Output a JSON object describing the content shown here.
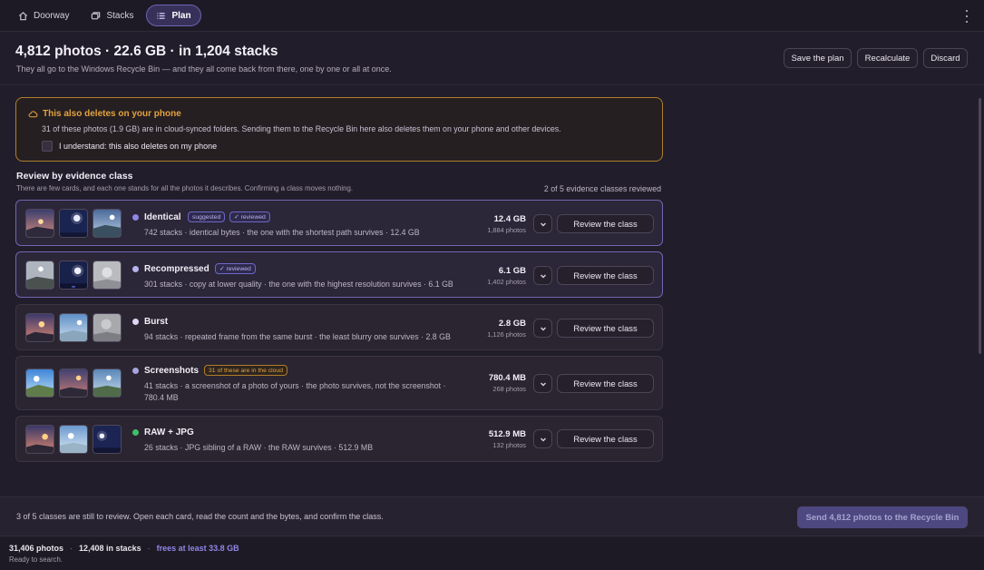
{
  "tabs": [
    {
      "label": "Doorway",
      "icon": "home-icon",
      "active": false
    },
    {
      "label": "Stacks",
      "icon": "stacks-icon",
      "active": false
    },
    {
      "label": "Plan",
      "icon": "list-icon",
      "active": true
    }
  ],
  "header": {
    "title": "4,812 photos · 22.6 GB · in 1,204 stacks",
    "subtitle": "They all go to the Windows Recycle Bin — and they all come back from there, one by one or all at once.",
    "buttons": {
      "save": "Save the plan",
      "recalc": "Recalculate",
      "discard": "Discard"
    }
  },
  "warning": {
    "title": "This also deletes on your phone",
    "text": "31 of these photos (1.9 GB) are in cloud-synced folders. Sending them to the Recycle Bin here also deletes them on your phone and other devices.",
    "checkbox_label": "I understand: this also deletes on my phone",
    "checked": false,
    "color": "#e3a23c"
  },
  "review": {
    "title": "Review by evidence class",
    "subtitle": "There are few cards, and each one stands for all the photos it describes. Confirming a class moves nothing.",
    "progress": "2 of 5 evidence classes reviewed"
  },
  "classes": [
    {
      "name": "Identical",
      "pills": [
        "suggested",
        "✓ reviewed"
      ],
      "desc": "742 stacks · identical bytes · the one with the shortest path survives · 12.4 GB",
      "size": "12.4 GB",
      "count": "1,884 photos",
      "button": "Review the class",
      "dot": "#8f87e6"
    },
    {
      "name": "Recompressed",
      "pills": [
        "✓ reviewed"
      ],
      "desc": "301 stacks · copy at lower quality · the one with the highest resolution survives · 6.1 GB",
      "size": "6.1 GB",
      "count": "1,402 photos",
      "button": "Review the class",
      "dot": "#b8b2ee"
    },
    {
      "name": "Burst",
      "pills": [],
      "desc": "94 stacks · repeated frame from the same burst · the least blurry one survives · 2.8 GB",
      "size": "2.8 GB",
      "count": "1,126 photos",
      "button": "Review the class",
      "dot": "#dcd8f3"
    },
    {
      "name": "Screenshots",
      "pills": [
        "31 of these are in the cloud"
      ],
      "desc1": "41 stacks · a screenshot of a photo of yours · the photo survives, not the screenshot ·",
      "desc2": "780.4 MB",
      "size": "780.4 MB",
      "count": "268 photos",
      "button": "Review the class",
      "dot": "#a8a4dc"
    },
    {
      "name": "RAW + JPG",
      "pills": [],
      "desc": "26 stacks · JPG sibling of a RAW · the RAW survives · 512.9 MB",
      "size": "512.9 MB",
      "count": "132 photos",
      "button": "Review the class",
      "dot": "#3fbf6a"
    }
  ],
  "action_bar": {
    "message": "3 of 5 classes are still to review. Open each card, read the count and the bytes, and confirm the class.",
    "send": "Send 4,812 photos to the Recycle Bin"
  },
  "status": {
    "photos": "31,406 photos",
    "stacks": "12,408 in stacks",
    "frees": "frees at least 33.8 GB",
    "state": "Ready to search."
  },
  "colors": {
    "accent": "#8f87e6",
    "warning": "#e3a23c",
    "ok": "#3fbf6a"
  }
}
